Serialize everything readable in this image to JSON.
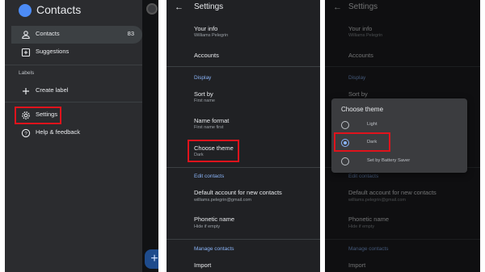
{
  "drawer": {
    "app_title": "Contacts",
    "items": [
      {
        "label": "Contacts",
        "count": "83"
      },
      {
        "label": "Suggestions"
      }
    ],
    "labels_header": "Labels",
    "create_label": "Create label",
    "settings": "Settings",
    "help": "Help & feedback",
    "fab_symbol": "+"
  },
  "settings": {
    "back_symbol": "←",
    "title": "Settings",
    "your_info": {
      "title": "Your info",
      "sub": "Williams Pelegrin"
    },
    "accounts": "Accounts",
    "display_header": "Display",
    "sort_by": {
      "title": "Sort by",
      "sub": "First name"
    },
    "name_format": {
      "title": "Name format",
      "sub": "First name first"
    },
    "choose_theme": {
      "title": "Choose theme",
      "sub": "Dark"
    },
    "edit_contacts_header": "Edit contacts",
    "default_account": {
      "title": "Default account for new contacts",
      "sub": "williams.pelegrin@gmail.com"
    },
    "phonetic_name": {
      "title": "Phonetic name",
      "sub": "Hide if empty"
    },
    "manage_contacts_header": "Manage contacts",
    "import": "Import"
  },
  "dialog": {
    "title": "Choose theme",
    "options": [
      {
        "label": "Light",
        "selected": false
      },
      {
        "label": "Dark",
        "selected": true
      },
      {
        "label": "Set by Battery Saver",
        "selected": false
      }
    ]
  },
  "colors": {
    "highlight": "#e0131c",
    "accent": "#8ab4f8",
    "background": "#202124"
  }
}
